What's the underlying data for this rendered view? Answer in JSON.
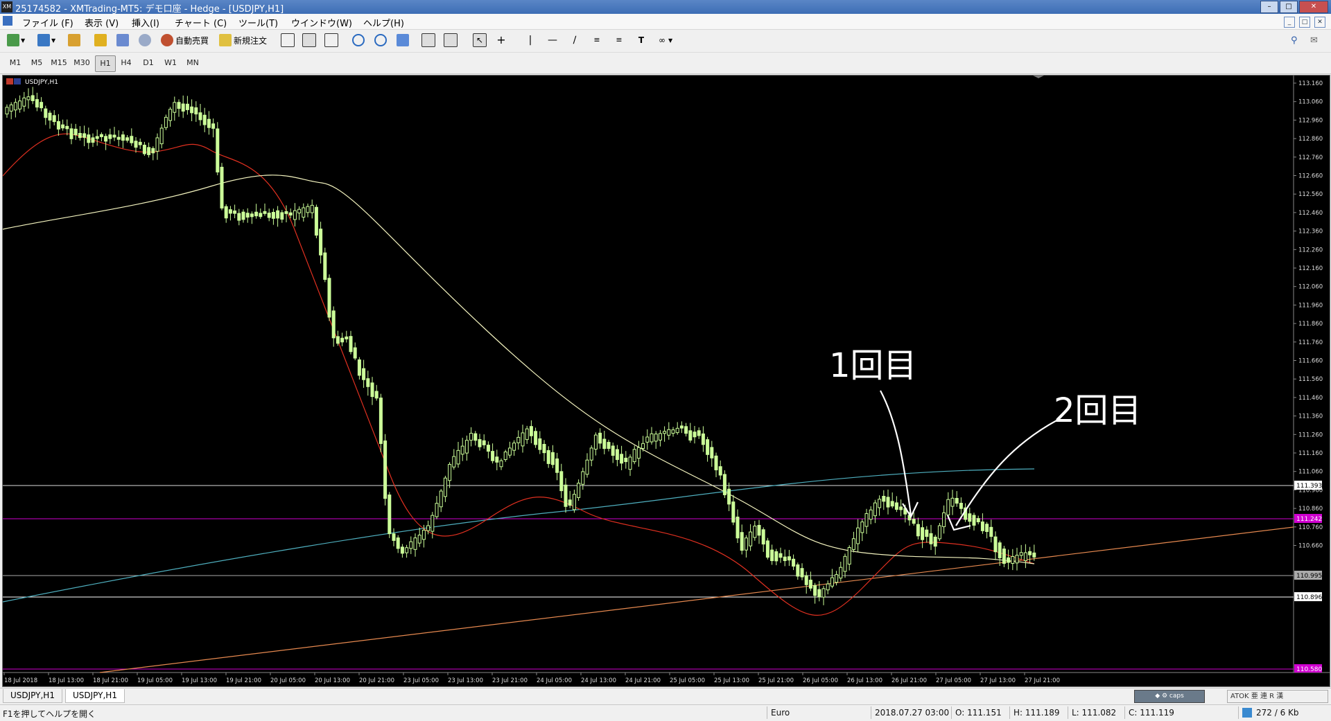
{
  "window": {
    "title": "25174582 - XMTrading-MT5: デモ口座 - Hedge - [USDJPY,H1]",
    "app_icon": "XM",
    "controls": [
      "minimize-icon",
      "maximize-icon",
      "close-icon"
    ]
  },
  "menu": {
    "items": [
      "ファイル (F)",
      "表示 (V)",
      "挿入(I)",
      "チャート (C)",
      "ツール(T)",
      "ウインドウ(W)",
      "ヘルプ(H)"
    ]
  },
  "toolbar": {
    "auto_trade": "自動売買",
    "new_order": "新規注文"
  },
  "timeframes": [
    "M1",
    "M5",
    "M15",
    "M30",
    "H1",
    "H4",
    "D1",
    "W1",
    "MN"
  ],
  "active_timeframe": "H1",
  "chart": {
    "symbol_label": "USDJPY,H1",
    "price_labels": [
      "113.160",
      "113.060",
      "112.960",
      "112.860",
      "112.760",
      "112.660",
      "112.560",
      "112.460",
      "112.360",
      "112.260",
      "112.160",
      "112.060",
      "111.960",
      "111.860",
      "111.760",
      "111.660",
      "111.560",
      "111.460",
      "111.360",
      "111.260",
      "111.160",
      "111.060",
      "110.960",
      "110.860",
      "110.760",
      "110.660"
    ],
    "hline_tags": {
      "h1": "111.393",
      "h2": "111.242",
      "h3": "110.995",
      "h4": "110.896",
      "h5": "110.580"
    },
    "time_labels": [
      "18 Jul 2018",
      "18 Jul 13:00",
      "18 Jul 21:00",
      "19 Jul 05:00",
      "19 Jul 13:00",
      "19 Jul 21:00",
      "20 Jul 05:00",
      "20 Jul 13:00",
      "20 Jul 21:00",
      "23 Jul 05:00",
      "23 Jul 13:00",
      "23 Jul 21:00",
      "24 Jul 05:00",
      "24 Jul 13:00",
      "24 Jul 21:00",
      "25 Jul 05:00",
      "25 Jul 13:00",
      "25 Jul 21:00",
      "26 Jul 05:00",
      "26 Jul 13:00",
      "26 Jul 21:00",
      "27 Jul 05:00",
      "27 Jul 13:00",
      "27 Jul 21:00"
    ],
    "annotations": [
      "1回目",
      "2回目"
    ],
    "colors": {
      "background": "#000000",
      "candle": "#ccff99",
      "ma_fast": "#e03020",
      "ma_slow": "#f5f5c0",
      "trend_blue": "#4fb0c0",
      "trend_orange": "#e88a50",
      "hline_magenta": "#ff00ff",
      "hline_white": "#ffffff"
    }
  },
  "bottom_tabs": [
    "USDJPY,H1",
    "USDJPY,H1"
  ],
  "active_bottom_tab": 1,
  "statusbar": {
    "help": "F1を押してヘルプを開く",
    "profile": "Euro",
    "datetime": "2018.07.27 03:00",
    "open": "O: 111.151",
    "high": "H: 111.189",
    "low": "L: 111.082",
    "close": "C: 111.119",
    "traffic": "272 / 6 Kb",
    "ime": "ATOK 亜 連 R 漢"
  }
}
